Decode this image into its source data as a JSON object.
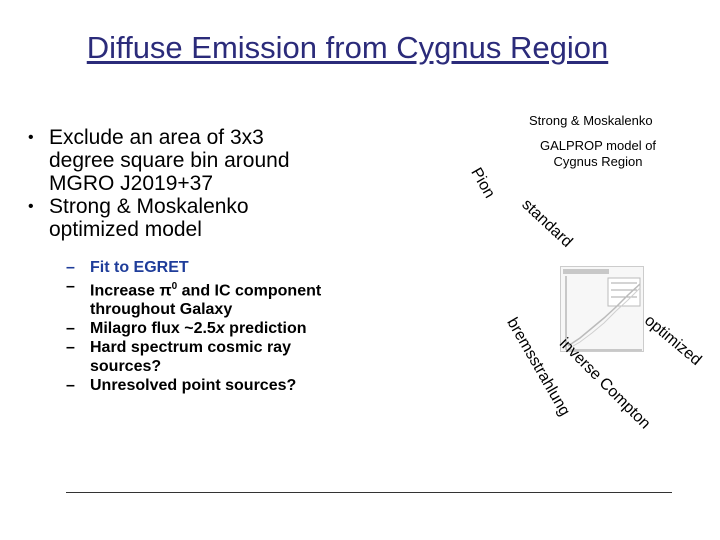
{
  "slide": {
    "title": "Diffuse Emission from Cygnus Region",
    "bullets": [
      "Exclude an area of 3x3 degree square bin around MGRO J2019+37",
      "Strong & Moskalenko optimized model"
    ],
    "sub_bullets": [
      "Fit to EGRET",
      "Increase π",
      "0",
      " and IC component throughout Galaxy",
      "Milagro flux ~2.5",
      "x",
      " prediction",
      "Hard spectrum cosmic ray sources?",
      "Unresolved point sources?"
    ],
    "figure": {
      "reference": "Strong & Moskalenko",
      "caption": "GALPROP model of Cygnus Region",
      "labels": {
        "pion": "Pion",
        "standard": "standard",
        "optimized": "optimized",
        "bremsstrahlung": "bremsstrahlung",
        "inverse_compton": "inverse Compton"
      }
    },
    "colors": {
      "title": "#2b2b7a",
      "sub_text": "#1f3d9a"
    }
  }
}
